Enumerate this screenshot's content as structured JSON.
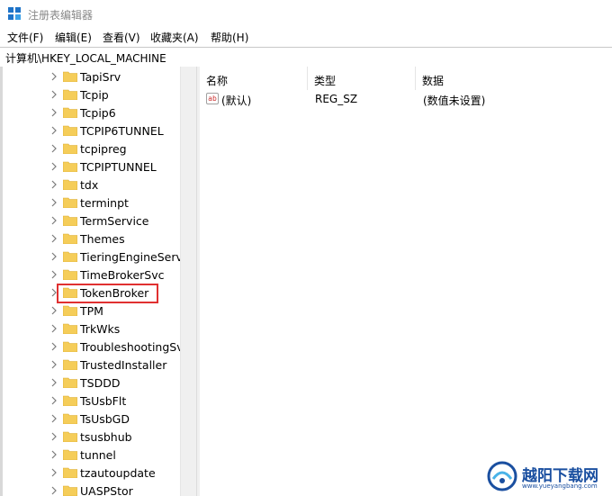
{
  "window": {
    "title": "注册表编辑器"
  },
  "menu": [
    "文件(F)",
    "编辑(E)",
    "查看(V)",
    "收藏夹(A)",
    "帮助(H)"
  ],
  "address": "计算机\\HKEY_LOCAL_MACHINE",
  "tree": [
    {
      "label": "TapiSrv",
      "expandable": true
    },
    {
      "label": "Tcpip",
      "expandable": true
    },
    {
      "label": "Tcpip6",
      "expandable": true
    },
    {
      "label": "TCPIP6TUNNEL",
      "expandable": true
    },
    {
      "label": "tcpipreg",
      "expandable": true
    },
    {
      "label": "TCPIPTUNNEL",
      "expandable": true
    },
    {
      "label": "tdx",
      "expandable": true
    },
    {
      "label": "terminpt",
      "expandable": true
    },
    {
      "label": "TermService",
      "expandable": true
    },
    {
      "label": "Themes",
      "expandable": true
    },
    {
      "label": "TieringEngineServic",
      "expandable": true
    },
    {
      "label": "TimeBrokerSvc",
      "expandable": true
    },
    {
      "label": "TokenBroker",
      "expandable": true
    },
    {
      "label": "TPM",
      "expandable": true
    },
    {
      "label": "TrkWks",
      "expandable": true
    },
    {
      "label": "TroubleshootingSv",
      "expandable": true
    },
    {
      "label": "TrustedInstaller",
      "expandable": true
    },
    {
      "label": "TSDDD",
      "expandable": true
    },
    {
      "label": "TsUsbFlt",
      "expandable": true
    },
    {
      "label": "TsUsbGD",
      "expandable": true
    },
    {
      "label": "tsusbhub",
      "expandable": true
    },
    {
      "label": "tunnel",
      "expandable": true
    },
    {
      "label": "tzautoupdate",
      "expandable": true
    },
    {
      "label": "UASPStor",
      "expandable": true
    }
  ],
  "columns": {
    "name": "名称",
    "type": "类型",
    "data": "数据"
  },
  "values": [
    {
      "icon": "ab",
      "name": "(默认)",
      "type": "REG_SZ",
      "data": "(数值未设置)"
    }
  ],
  "watermark": {
    "title": "越阳下载网",
    "url": "www.yueyangbang.com"
  },
  "colors": {
    "folder": "#f5cd59",
    "highlight_box": "#e03030",
    "watermark": "#1a4fa0"
  }
}
